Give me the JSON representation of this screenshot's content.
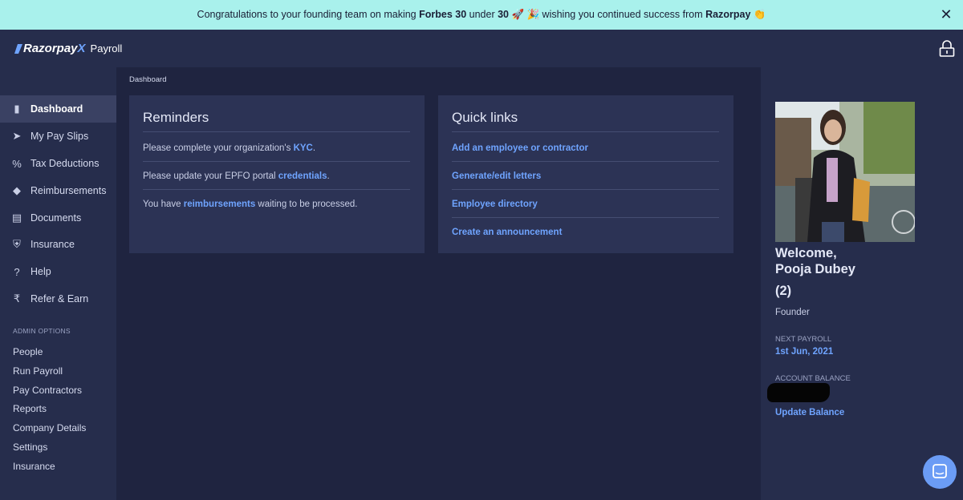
{
  "banner": {
    "text_1": "Congratulations to your founding team on making ",
    "bold_1": "Forbes 30",
    "text_2": " under ",
    "bold_2": "30",
    "text_3": " 🚀 🎉 wishing you continued success from ",
    "bold_3": "Razorpay",
    "text_4": " 👏",
    "close_label": "✕"
  },
  "header": {
    "brand": "Razorpay",
    "brand_x": "X",
    "product": "Payroll"
  },
  "sidebar": {
    "items": [
      {
        "label": "Dashboard",
        "icon": "clipboard-icon",
        "glyph": "▮",
        "active": true
      },
      {
        "label": "My Pay Slips",
        "icon": "send-icon",
        "glyph": "➤"
      },
      {
        "label": "Tax Deductions",
        "icon": "percent-icon",
        "glyph": "%"
      },
      {
        "label": "Reimbursements",
        "icon": "tag-icon",
        "glyph": "◆"
      },
      {
        "label": "Documents",
        "icon": "documents-icon",
        "glyph": "▤"
      },
      {
        "label": "Insurance",
        "icon": "shield-icon",
        "glyph": "⛨"
      },
      {
        "label": "Help",
        "icon": "question-icon",
        "glyph": "?"
      },
      {
        "label": "Refer & Earn",
        "icon": "rupee-icon",
        "glyph": "₹"
      }
    ],
    "admin_title": "ADMIN OPTIONS",
    "admin_items": [
      "People",
      "Run Payroll",
      "Pay Contractors",
      "Reports",
      "Company Details",
      "Settings",
      "Insurance"
    ]
  },
  "main": {
    "breadcrumb": "Dashboard",
    "reminders": {
      "title": "Reminders",
      "r1_pre": "Please complete your organization's ",
      "r1_link": "KYC",
      "r1_post": ".",
      "r2_pre": "Please update your EPFO portal ",
      "r2_link": "credentials",
      "r2_post": ".",
      "r3_pre": "You have ",
      "r3_link": "reimbursements",
      "r3_post": " waiting to be processed."
    },
    "quick_links": {
      "title": "Quick links",
      "links": [
        "Add an employee or contractor",
        "Generate/edit letters",
        "Employee directory",
        "Create an announcement"
      ]
    }
  },
  "profile": {
    "welcome": "Welcome,",
    "name": "Pooja Dubey",
    "count": "(2)",
    "role": "Founder",
    "next_payroll_label": "NEXT PAYROLL",
    "next_payroll_value": "1st Jun, 2021",
    "balance_label": "ACCOUNT BALANCE",
    "update_balance": "Update Balance"
  },
  "colors": {
    "banner": "#a9f1ec",
    "accent": "#6fa4ff",
    "background": "#1f2440",
    "panel": "#262d4c",
    "card": "#2c3355"
  }
}
